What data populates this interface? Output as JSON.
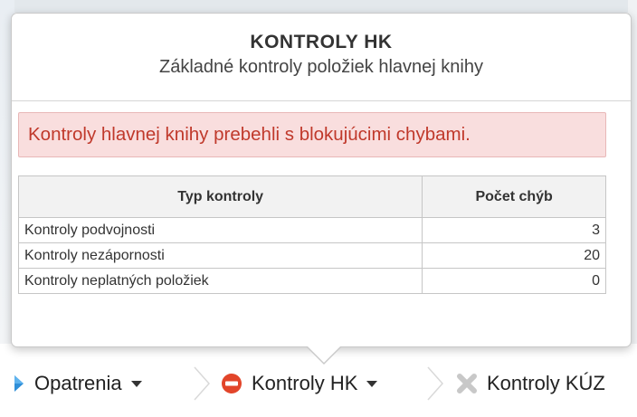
{
  "popover": {
    "title": "KONTROLY HK",
    "subtitle": "Základné kontroly položiek hlavnej knihy",
    "alert": "Kontroly hlavnej knihy prebehli s blokujúcimi chybami."
  },
  "table": {
    "headers": [
      "Typ kontroly",
      "Počet chýb"
    ],
    "rows": [
      {
        "type": "Kontroly podvojnosti",
        "count": "3"
      },
      {
        "type": "Kontroly nezápornosti",
        "count": "20"
      },
      {
        "type": "Kontroly neplatných položiek",
        "count": "0"
      }
    ]
  },
  "breadcrumb": {
    "items": [
      {
        "label": "Opatrenia",
        "icon": "play-triangle-icon",
        "color": "#2f8fd8"
      },
      {
        "label": "Kontroly HK",
        "icon": "no-entry-icon",
        "color": "#e2452a"
      },
      {
        "label": "Kontroly KÚZ",
        "icon": "cross-icon",
        "color": "#c8c8c8"
      }
    ]
  },
  "colors": {
    "alert_bg": "#f9dede",
    "alert_text": "#c0392b",
    "header_bg": "#f2f2f2"
  }
}
